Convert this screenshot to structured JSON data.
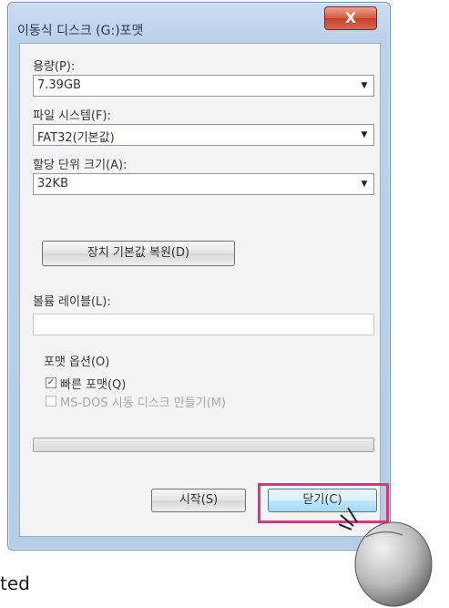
{
  "dialog": {
    "title": "이동식 디스크 (G:)포맷",
    "close_label": "X"
  },
  "capacity": {
    "label": "용량(P):",
    "value": "7.39GB"
  },
  "filesystem": {
    "label": "파일 시스템(F):",
    "value": "FAT32(기본값)"
  },
  "allocation": {
    "label": "할당 단위 크기(A):",
    "value": "32KB"
  },
  "restore_defaults_label": "장치 기본값 복원(D)",
  "volume_label": {
    "label": "볼륨 레이블(L):",
    "value": ""
  },
  "format_options": {
    "label": "포맷 옵션(O)",
    "quick_format": {
      "label": "빠른 포맷(Q)",
      "checked": true
    },
    "msdos_startup": {
      "label": "MS-DOS 시동 디스크 만들기(M)",
      "checked": false,
      "disabled": true
    }
  },
  "progress": {
    "value": 0
  },
  "buttons": {
    "start": "시작(S)",
    "close": "닫기(C)"
  },
  "caption_text": "ted",
  "colors": {
    "highlight": "#d4387d",
    "close_button": "#c2412b"
  }
}
